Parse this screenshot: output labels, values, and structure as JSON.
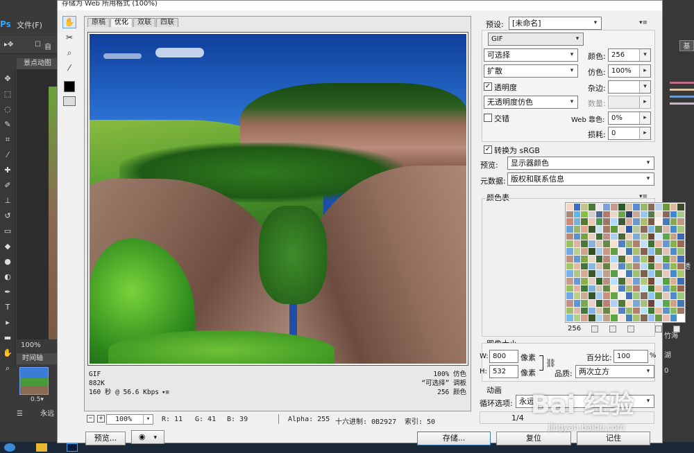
{
  "app": {
    "logo": "Ps",
    "menu_file": "文件(F)",
    "option_extra": "自",
    "doc_tab": "景点动图",
    "canvas_zoom": "100%",
    "timeline_tab": "时间轴",
    "frame_time": "0.5▾",
    "loop": "永远",
    "right_btn": "基",
    "right_labels": [
      "不透明",
      "竹海",
      "湖",
      "0"
    ]
  },
  "dialog": {
    "title": "存储为 Web 所用格式 (100%)",
    "tools": [
      "hand-tool",
      "slice-select-tool",
      "zoom-tool",
      "eyedropper-tool"
    ]
  },
  "preview": {
    "tabs": [
      "原稿",
      "优化",
      "双联",
      "四联"
    ],
    "active_tab": 1,
    "info_left": [
      "GIF",
      "882K",
      "160 秒 @ 56.6 Kbps"
    ],
    "info_right": [
      "100% 仿色",
      "“可选择” 调板",
      "256 颜色"
    ]
  },
  "status": {
    "zoom": "100%",
    "r": "R: 11",
    "g": "G: 41",
    "b": "B: 39",
    "alpha": "Alpha: 255",
    "hex": "十六进制: 0B2927",
    "index": "索引: 50"
  },
  "buttons": {
    "preview": "预览...",
    "save": "存储...",
    "reset": "复位",
    "remember": "记住"
  },
  "settings": {
    "preset_label": "预设:",
    "preset_value": "[未命名]",
    "format": "GIF",
    "reduction": "可选择",
    "dither_algo": "扩散",
    "colors_label": "颜色:",
    "colors_value": "256",
    "dither_label": "仿色:",
    "dither_value": "100%",
    "transparency_label": "透明度",
    "transparency_checked": true,
    "matte_label": "杂边:",
    "matte_value": "",
    "transparency_dither": "无透明度仿色",
    "amount_label": "数量:",
    "amount_value": "",
    "interlaced_label": "交错",
    "interlaced_checked": false,
    "web_snap_label": "Web 靠色:",
    "web_snap_value": "0%",
    "lossy_label": "损耗:",
    "lossy_value": "0",
    "convert_srgb_label": "转换为 sRGB",
    "convert_srgb_checked": true,
    "preview_label": "预览:",
    "preview_value": "显示器颜色",
    "metadata_label": "元数据:",
    "metadata_value": "版权和联系信息"
  },
  "color_table": {
    "title": "颜色表",
    "count": "256",
    "colors": [
      "#f4d6c2",
      "#3a6cc0",
      "#c2c28a",
      "#4a7a3a",
      "#e8e8e8",
      "#7aa2d8",
      "#c89a86",
      "#2a5a2a",
      "#d8c0a8",
      "#5a8ad0",
      "#9ab86a",
      "#8a6a5a",
      "#b8d0e8",
      "#6a9a3a",
      "#e0b8a0",
      "#3a4a2a",
      "#a88a78",
      "#5ab8e8",
      "#88c040",
      "#d0d0d0",
      "#4a6a9a",
      "#b87868",
      "#e8d8c8",
      "#6aa848",
      "#2a3a6a",
      "#c8a898",
      "#98c8f0",
      "#5a7a4a",
      "#f0e0d0",
      "#886858",
      "#3a8ad8",
      "#a8c888",
      "#cc8878",
      "#78b0e0",
      "#587838",
      "#e8c8b8",
      "#4a9a4a",
      "#9a7868",
      "#b0d8f8",
      "#3a5a3a",
      "#d8a898",
      "#6a98c8",
      "#aac070",
      "#7a5848",
      "#f8f0e8",
      "#4878b8",
      "#88a858",
      "#c09888",
      "#68a0d8",
      "#98b868",
      "#e0a890",
      "#385828",
      "#c8e0f0",
      "#a87868",
      "#5a9838",
      "#f0d8c8",
      "#2858a8",
      "#b8c898",
      "#906858",
      "#88b8e8",
      "#6a8848",
      "#d8b8a8",
      "#4a88c8",
      "#a0c878",
      "#b88878",
      "#5890d0",
      "#78a040",
      "#e8d0c0",
      "#3a7030",
      "#c09080",
      "#a8d0f0",
      "#486838",
      "#f0c8b8",
      "#7aa8d8",
      "#b0c880",
      "#6a4838",
      "#d0e8f8",
      "#58a848",
      "#c8a088",
      "#3868b8",
      "#9ac060",
      "#e0b0a0",
      "#4a7838",
      "#8ab0e0",
      "#d8c8b8",
      "#688848",
      "#f8e0d0",
      "#5080c0",
      "#a0b870",
      "#b08070",
      "#c0e0f8",
      "#407030",
      "#e8b8a8",
      "#6898d0",
      "#88b050",
      "#9a6858",
      "#70a8e0",
      "#b8d088",
      "#d0a090",
      "#305020",
      "#a0c8e8",
      "#c89888",
      "#60a040",
      "#f0e8e0",
      "#4070b0",
      "#a8c070",
      "#886050",
      "#90c0f0",
      "#709048",
      "#e0c0b0",
      "#5088c8",
      "#98c070",
      "#c09080",
      "#6098d8",
      "#80a848",
      "#e8d8c8",
      "#3a6830",
      "#b88878",
      "#b0d8f8",
      "#507038",
      "#f8d0c0",
      "#78a0d0",
      "#a8c878",
      "#704838",
      "#c8e0f0",
      "#60a040",
      "#d0a890",
      "#4070b8",
      "#a0c868",
      "#e8b8a0",
      "#487040",
      "#88b8e8",
      "#d8c0b0",
      "#688040",
      "#f0e0d8",
      "#5888c8",
      "#98b878",
      "#b08878",
      "#b8d8f0",
      "#487838",
      "#e0b0a0",
      "#6890c8",
      "#90b858",
      "#a07060",
      "#78b0e8",
      "#b0c880",
      "#d8a898",
      "#385830",
      "#a8d0f0",
      "#c0a090",
      "#58a048",
      "#f8f0e8",
      "#4878b8",
      "#a0c078",
      "#806048",
      "#98c8f0",
      "#689048",
      "#e8c8b8",
      "#4888c8",
      "#a8c870",
      "#c89888",
      "#6898d8",
      "#88b050",
      "#e0d0c0",
      "#306828",
      "#b89080",
      "#b8e0f8",
      "#487038",
      "#f0c8b8",
      "#70a0d0",
      "#b0c880",
      "#784838",
      "#d0e8f8",
      "#58a040",
      "#d8b098",
      "#3870b8",
      "#98c060",
      "#e8b0a0",
      "#407838",
      "#80b0e0",
      "#d0c8b8",
      "#608848",
      "#f8e8d8",
      "#5080c0",
      "#a8b870",
      "#b88070",
      "#c0e8f8",
      "#407030",
      "#e8c0a8",
      "#6898d0",
      "#80b050",
      "#9a6050",
      "#70a8e8",
      "#b8d080",
      "#d0a898",
      "#305828",
      "#a0c8f0",
      "#c89080",
      "#60a848",
      "#f0f0e8",
      "#4070b8",
      "#a0c878",
      "#886858",
      "#90c8f0",
      "#689848",
      "#e0c8b8",
      "#5088d0",
      "#98c878",
      "#c09088",
      "#5898d8",
      "#78a850",
      "#e8d0c8",
      "#386830",
      "#b88070",
      "#b0d0f0",
      "#507838",
      "#f8d8c8",
      "#78a8d0",
      "#a8c080",
      "#704040",
      "#c8e8f8",
      "#58a848",
      "#d0a088",
      "#4078b8",
      "#a0c068",
      "#e0b8a8",
      "#487840",
      "#88b0e8",
      "#d8c8b0",
      "#688848",
      "#f0e0d0",
      "#5880c8",
      "#98b870",
      "#b08070",
      "#b8e0f0",
      "#407838",
      "#e8b8a0",
      "#6090c8",
      "#88b860",
      "#a07868",
      "#78b8e8",
      "#b0d088",
      "#d8a090",
      "#385828",
      "#a8d8f0",
      "#c0a088",
      "#58a840",
      "#f8e8e0",
      "#4880b8",
      "#a8c070",
      "#806850",
      "#98c0f0",
      "#709848",
      "#e8c0b0",
      "#4890c8",
      "#ffffff"
    ]
  },
  "image_size": {
    "title": "图像大小",
    "w_label": "W:",
    "w_value": "800",
    "h_label": "H:",
    "h_value": "532",
    "unit": "像素",
    "percent_label": "百分比:",
    "percent_value": "100",
    "percent_unit": "%",
    "quality_label": "品质:",
    "quality_value": "两次立方"
  },
  "animation": {
    "title": "动画",
    "loop_label": "循环选项:",
    "loop_value": "永远",
    "frame_counter": "1/4"
  },
  "watermark": {
    "text": "Bai 经验",
    "url": "jingyan.baidu.com"
  },
  "colors": {
    "dialog_bg": "#f0f0f0",
    "ps_bg": "#3a3a3a",
    "accent": "#3c7fb1"
  }
}
